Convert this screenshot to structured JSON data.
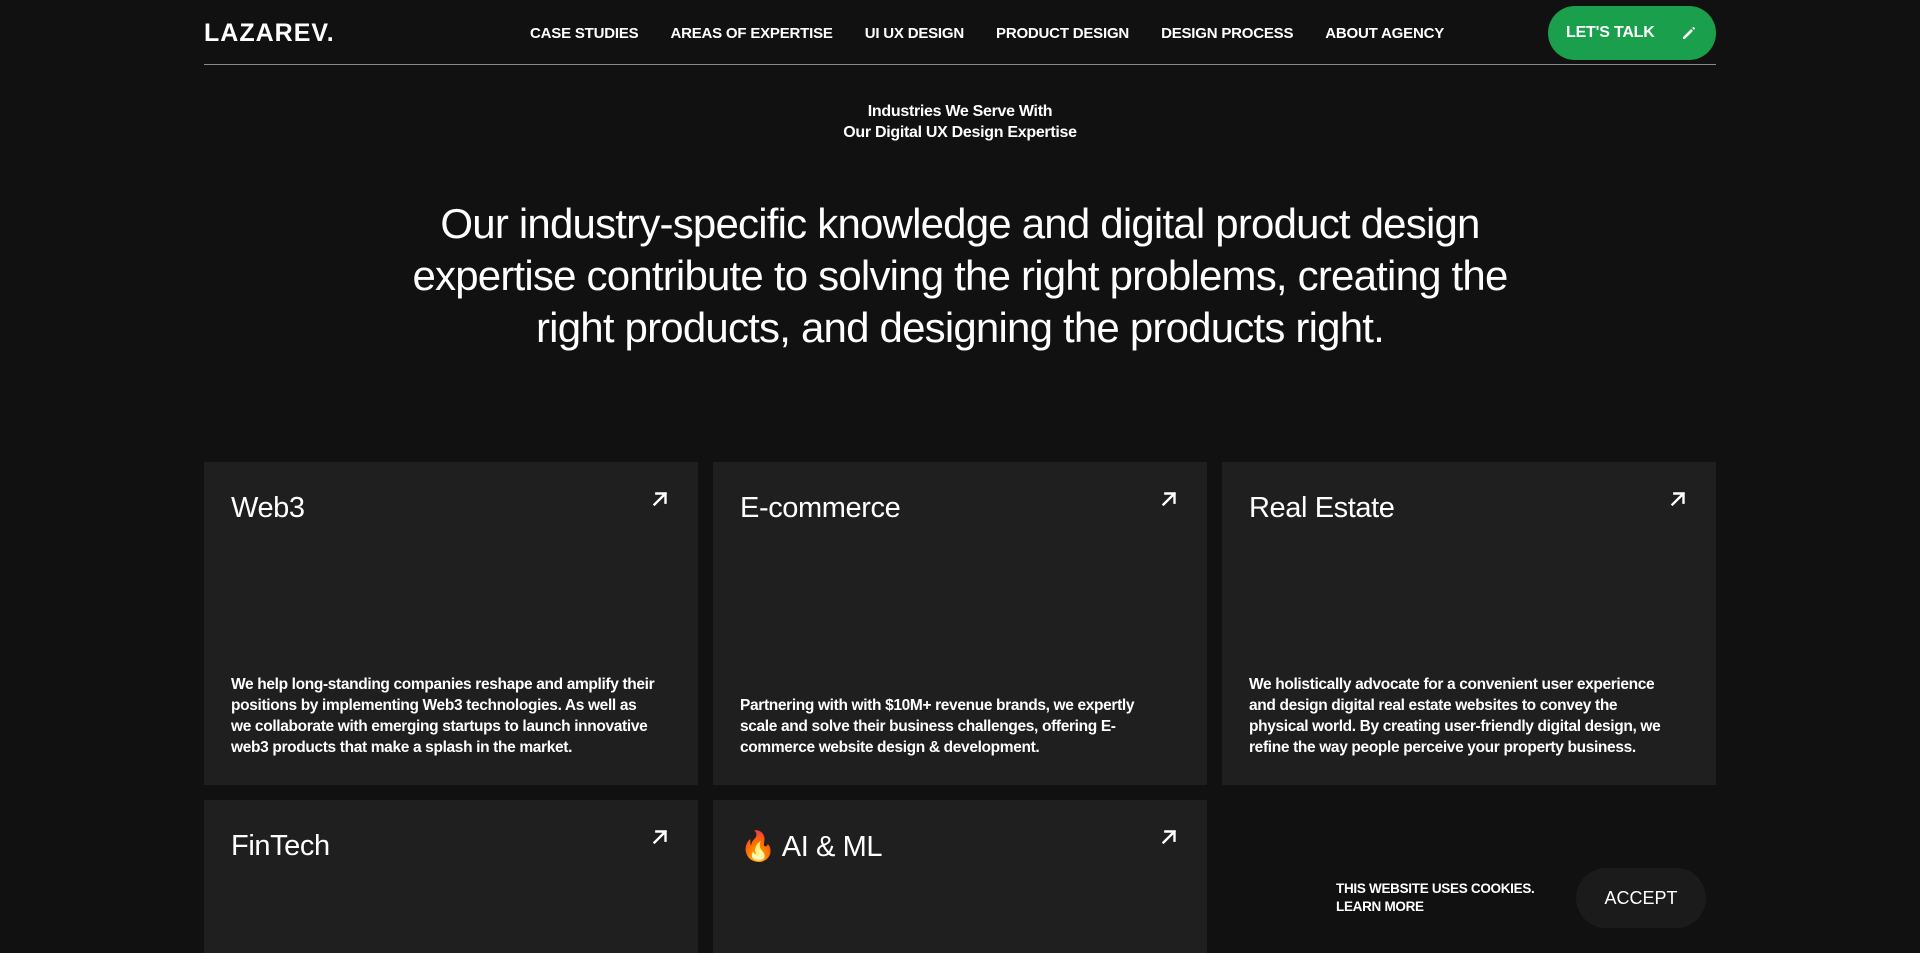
{
  "header": {
    "logo": "LAZAREV.",
    "nav": [
      "CASE STUDIES",
      "AREAS OF EXPERTISE",
      "UI UX DESIGN",
      "PRODUCT DESIGN",
      "DESIGN PROCESS",
      "ABOUT AGENCY"
    ],
    "cta_label": "LET'S TALK",
    "cta_icon": "pencil-icon",
    "cta_color": "#1aa04d"
  },
  "hero": {
    "eyebrow_line1": "Industries We Serve With",
    "eyebrow_line2": "Our Digital UX Design Expertise",
    "lead": "Our industry-specific knowledge and digital product design expertise contribute to solving the right problems, creating the right products, and designing the products right."
  },
  "cards": [
    {
      "title": "Web3",
      "description": "We help long-standing companies reshape and amplify their positions by implementing Web3 technologies. As well as we collaborate with emerging startups to launch innovative web3 products that make a splash in the market.",
      "icon": "arrow-up-right-icon"
    },
    {
      "title": "E-commerce",
      "description": "Partnering with with $10M+ revenue brands, we expertly scale and solve their business challenges, offering E-commerce website design & development.",
      "icon": "arrow-up-right-icon"
    },
    {
      "title": "Real Estate",
      "description": "We holistically advocate for a convenient user experience and design digital real estate websites to convey the physical world. By creating user-friendly digital design, we refine the way people perceive your property business.",
      "icon": "arrow-up-right-icon"
    },
    {
      "title": "FinTech",
      "description": "",
      "icon": "arrow-up-right-icon"
    },
    {
      "title": "🔥 AI & ML",
      "description": "",
      "icon": "arrow-up-right-icon"
    }
  ],
  "cookie": {
    "text": "THIS WEBSITE USES COOKIES.",
    "link": "LEARN MORE",
    "accept": "ACCEPT"
  }
}
